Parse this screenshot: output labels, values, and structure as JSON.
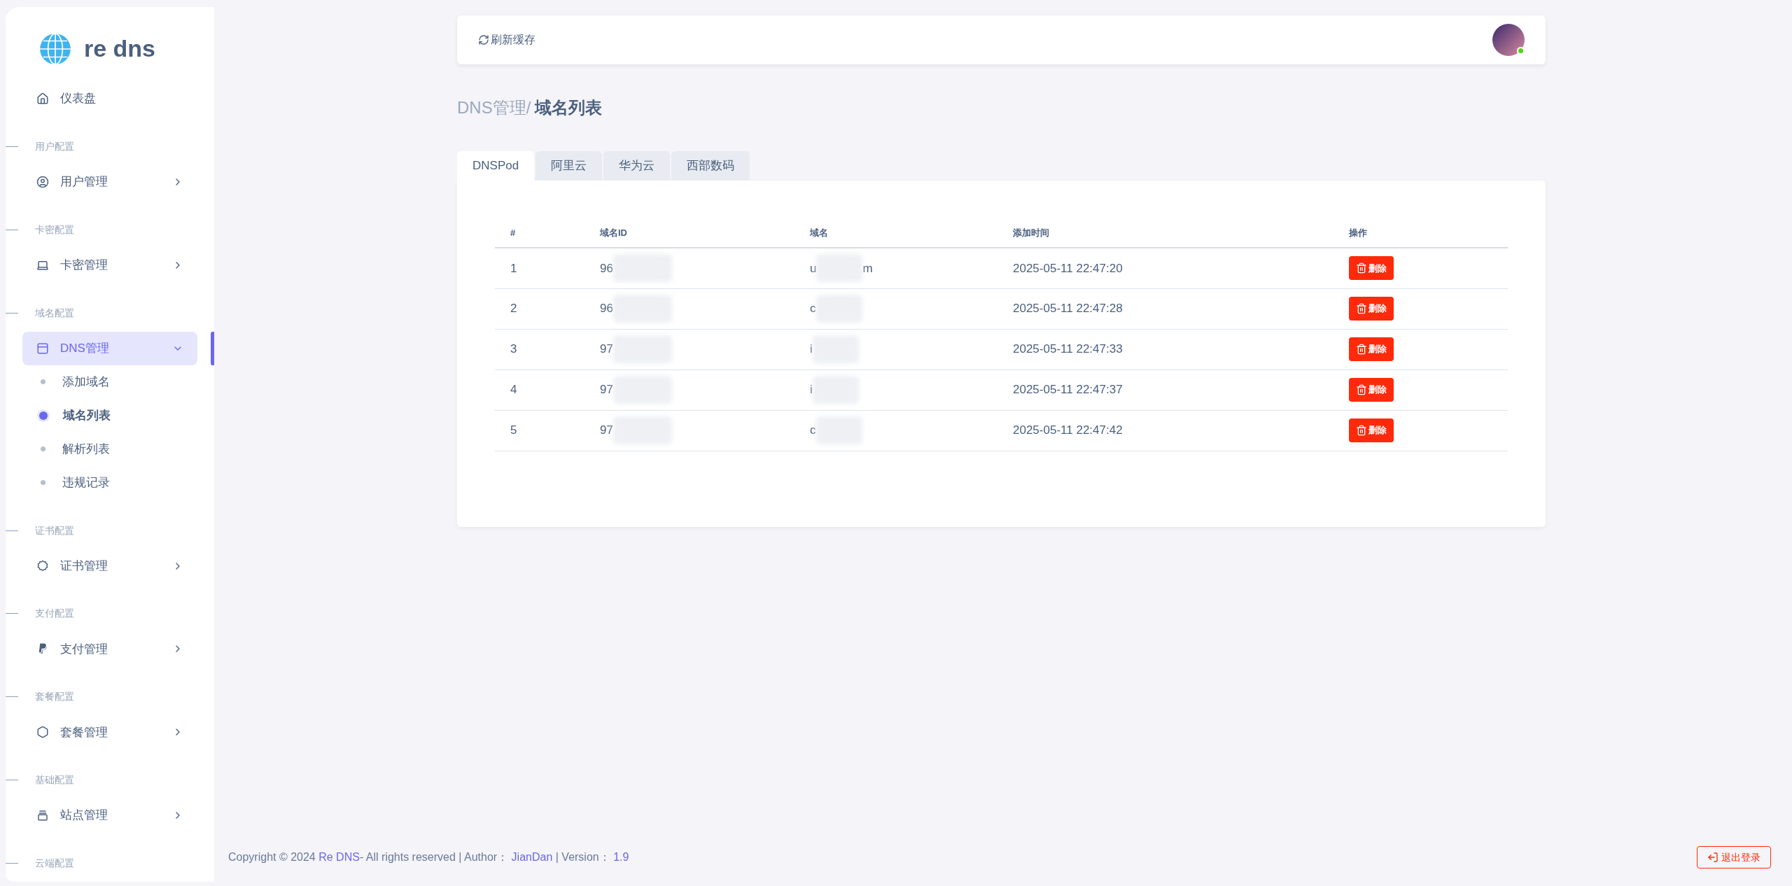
{
  "sidebar": {
    "logo": "re dns",
    "items": [
      {
        "kind": "link",
        "label": "仪表盘"
      },
      {
        "kind": "section",
        "label": "用户配置"
      },
      {
        "kind": "menu",
        "label": "用户管理",
        "expanded": false,
        "selected": false
      },
      {
        "kind": "section",
        "label": "卡密配置"
      },
      {
        "kind": "menu",
        "label": "卡密管理",
        "expanded": false,
        "selected": false
      },
      {
        "kind": "section",
        "label": "域名配置"
      },
      {
        "kind": "menu",
        "label": "DNS管理",
        "expanded": true,
        "selected": true,
        "children": [
          {
            "label": "添加域名",
            "selected": false
          },
          {
            "label": "域名列表",
            "selected": true
          },
          {
            "label": "解析列表",
            "selected": false
          },
          {
            "label": "违规记录",
            "selected": false
          }
        ]
      },
      {
        "kind": "section",
        "label": "证书配置"
      },
      {
        "kind": "menu",
        "label": "证书管理",
        "expanded": false,
        "selected": false
      },
      {
        "kind": "section",
        "label": "支付配置"
      },
      {
        "kind": "menu",
        "label": "支付管理",
        "expanded": false,
        "selected": false
      },
      {
        "kind": "section",
        "label": "套餐配置"
      },
      {
        "kind": "menu",
        "label": "套餐管理",
        "expanded": false,
        "selected": false
      },
      {
        "kind": "section",
        "label": "基础配置"
      },
      {
        "kind": "menu",
        "label": "站点管理",
        "expanded": false,
        "selected": false
      },
      {
        "kind": "section",
        "label": "云端配置"
      }
    ]
  },
  "header": {
    "refresh": "刷新缓存"
  },
  "breadcrumb": {
    "parent": "DNS管理/",
    "current": "域名列表"
  },
  "tabs": [
    {
      "label": "DNSPod",
      "selected": true
    },
    {
      "label": "阿里云",
      "selected": false
    },
    {
      "label": "华为云",
      "selected": false
    },
    {
      "label": "西部数码",
      "selected": false
    }
  ],
  "table": {
    "columns": [
      "#",
      "域名ID",
      "域名",
      "添加时间",
      "操作"
    ],
    "rows": [
      {
        "index": "1",
        "id": "96",
        "domain": "u",
        "domain_tail": "m",
        "time": "2025-05-11 22:47:20",
        "action": "删除"
      },
      {
        "index": "2",
        "id": "96",
        "domain": "c",
        "time": "2025-05-11 22:47:28",
        "action": "删除"
      },
      {
        "index": "3",
        "id": "97",
        "domain": "i",
        "time": "2025-05-11 22:47:33",
        "action": "删除"
      },
      {
        "index": "4",
        "id": "97",
        "domain": "i",
        "time": "2025-05-11 22:47:37",
        "action": "删除"
      },
      {
        "index": "5",
        "id": "97",
        "domain": "c",
        "time": "2025-05-11 22:47:42",
        "action": "删除"
      }
    ]
  },
  "footer": {
    "copyright": "Copyright © 2024",
    "brand": "Re DNS",
    "rights": "- All rights reserved | Author：",
    "author": "JianDan",
    "version_label": "| Version：",
    "version": "1.9",
    "logout": "退出登录"
  }
}
